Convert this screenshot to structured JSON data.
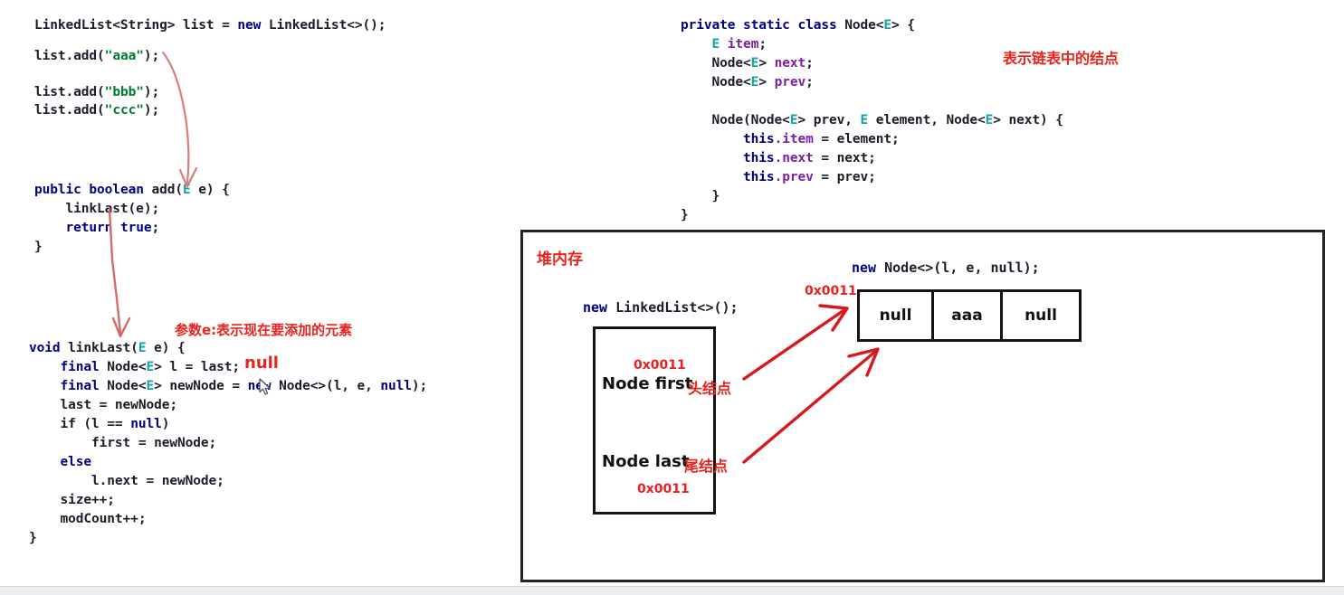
{
  "page": {
    "background": "#ffffff",
    "accent_red": "#e8221c",
    "keyword_blue": "#000080",
    "string_green": "#007a2f",
    "generic_teal": "#11a4a4",
    "field_purple": "#7b20a3"
  },
  "code_usage": {
    "name": "usage-snippet",
    "lines": [
      "LinkedList<String> list = new LinkedList<>();",
      "",
      "list.add(\"aaa\");",
      "list.add(\"bbb\");",
      "list.add(\"ccc\");"
    ],
    "line1_a": "LinkedList<String> list = ",
    "line1_kw": "new",
    "line1_b": " LinkedList<>();",
    "add_prefix": "list.add(",
    "add_q": "\"",
    "add_aaa": "aaa",
    "add_bbb": "bbb",
    "add_ccc": "ccc",
    "add_suffix": ");"
  },
  "code_add": {
    "name": "add-method",
    "l1_kw1": "public",
    "l1_kw2": "boolean",
    "l1_name": " add(",
    "l1_gen": "E",
    "l1_rest": " e) {",
    "l2": "    linkLast(e);",
    "l3_kw": "    return",
    "l3_kw2": " true",
    "l3_rest": ";",
    "l4": "}"
  },
  "code_linklast": {
    "name": "linklast-method",
    "l1_kw": "void",
    "l1_name": " linkLast(",
    "l1_gen": "E",
    "l1_rest": " e) {",
    "l2_kw": "    final",
    "l2_a": " Node<",
    "l2_gen": "E",
    "l2_b": "> l = last;",
    "l3_kw": "    final",
    "l3_a": " Node<",
    "l3_gen": "E",
    "l3_b": "> newNode = ",
    "l3_new": "new",
    "l3_c": " Node<>(l, e, ",
    "l3_null": "null",
    "l3_d": ");",
    "l4": "    last = newNode;",
    "l5_a": "    if (l == ",
    "l5_null": "null",
    "l5_b": ")",
    "l6": "        first = newNode;",
    "l7_kw": "    else",
    "l8": "        l.next = newNode;",
    "l9": "    size++;",
    "l10": "    modCount++;",
    "l11": "}"
  },
  "code_node_class": {
    "name": "node-inner-class",
    "l1_kw": "private static class",
    "l1_a": " Node<",
    "l1_gen": "E",
    "l1_b": "> {",
    "l2_gen": "E",
    "l2_fld": " item",
    "l2_end": ";",
    "l3_a": "    Node<",
    "l3_gen": "E",
    "l3_b": "> ",
    "l3_fld": "next",
    "l3_end": ";",
    "l4_a": "    Node<",
    "l4_gen": "E",
    "l4_b": "> ",
    "l4_fld": "prev",
    "l4_end": ";",
    "l6_a": "    Node(Node<",
    "l6_gen": "E",
    "l6_b": "> prev, ",
    "l6_gen2": "E",
    "l6_c": " element, Node<",
    "l6_gen3": "E",
    "l6_d": "> next) {",
    "l7_kw": "        this",
    "l7_fld": ".item",
    "l7_rest": " = element;",
    "l8_kw": "        this",
    "l8_fld": ".next",
    "l8_rest": " = next;",
    "l9_kw": "        this",
    "l9_fld": ".prev",
    "l9_rest": " = prev;",
    "l10": "    }",
    "l11": "}"
  },
  "annotations": {
    "node_class_note": "表示链表中的结点",
    "param_note": "参数e:表示现在要添加的元素",
    "last_is_null": "null"
  },
  "diagram": {
    "heap_title": "堆内存",
    "new_linkedlist": "new LinkedList<>();",
    "new_linkedlist_kw": "new",
    "new_linkedlist_rest": " LinkedList<>();",
    "new_node_kw": "new",
    "new_node_rest": " Node<>(l, e, null);",
    "new_node_full": "new Node<>(l, e, null);",
    "list_object": {
      "first_addr": "0x0011",
      "first_label": "Node first",
      "first_cn": "头结点",
      "last_label": "Node last",
      "last_cn": "尾结点",
      "last_addr": "0x0011"
    },
    "node_object": {
      "address": "0x0011",
      "cells": [
        "null",
        "aaa",
        "null"
      ]
    }
  }
}
